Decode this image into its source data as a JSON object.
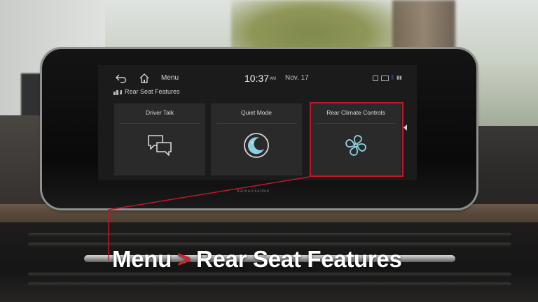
{
  "status_bar": {
    "menu_label": "Menu",
    "time": "10:37",
    "ampm": "AM",
    "date": "Nov. 17"
  },
  "breadcrumb": {
    "label": "Rear Seat Features"
  },
  "tiles": [
    {
      "label": "Driver Talk",
      "icon": "speech-bubbles-icon"
    },
    {
      "label": "Quiet Mode",
      "icon": "moon-icon"
    },
    {
      "label": "Rear Climate Controls",
      "icon": "fan-icon"
    }
  ],
  "bezel_brand": "harman/kardon",
  "caption": {
    "part1": "Menu",
    "separator": ">",
    "part2": "Rear Seat Features"
  },
  "colors": {
    "highlight": "#c0182a",
    "icon_accent": "#8fd0e0"
  }
}
